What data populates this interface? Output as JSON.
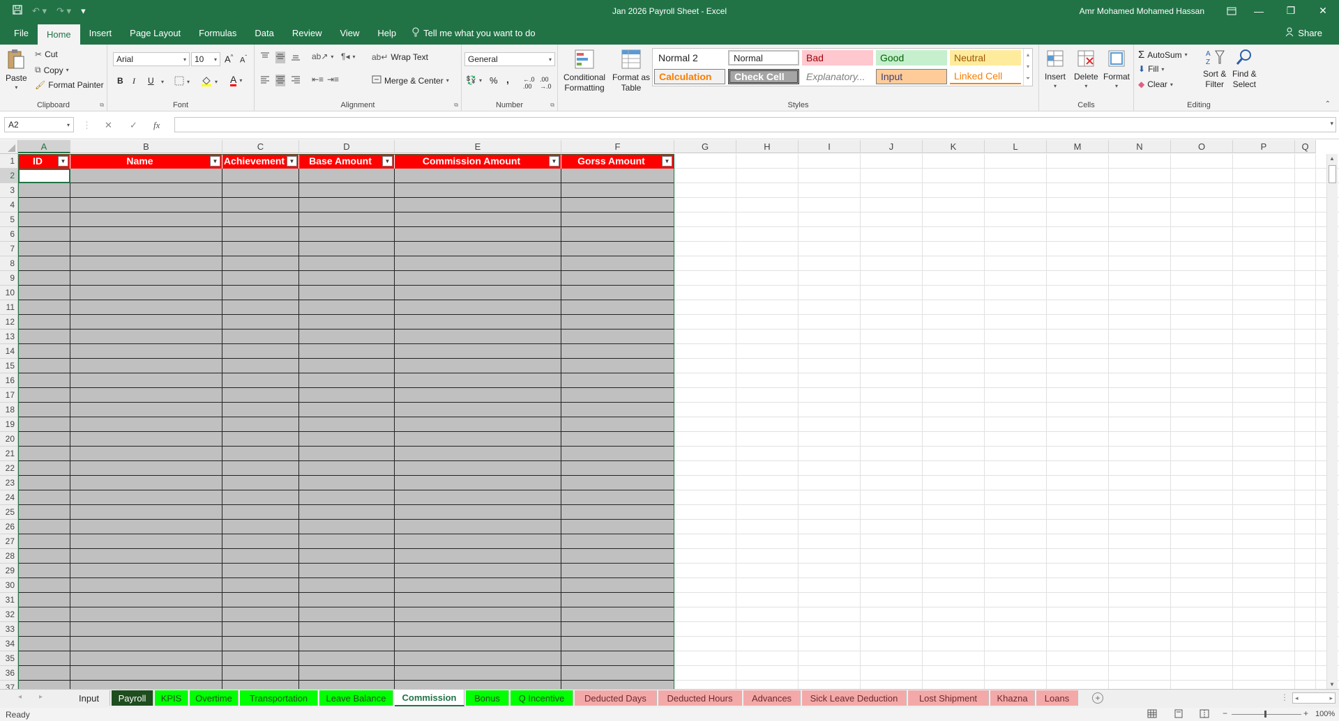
{
  "window": {
    "title": "Jan 2026 Payroll Sheet  -  Excel",
    "user": "Amr Mohamed Mohamed Hassan",
    "minimize": "—",
    "restore": "❐",
    "close": "✕"
  },
  "menu": {
    "file": "File",
    "home": "Home",
    "insert": "Insert",
    "page_layout": "Page Layout",
    "formulas": "Formulas",
    "data": "Data",
    "review": "Review",
    "view": "View",
    "help": "Help",
    "tell_me": "Tell me what you want to do",
    "share": "Share"
  },
  "ribbon": {
    "clipboard": {
      "label": "Clipboard",
      "paste": "Paste",
      "cut": "Cut",
      "copy": "Copy",
      "format_painter": "Format Painter"
    },
    "font": {
      "label": "Font",
      "name": "Arial",
      "size": "10",
      "bold": "B",
      "italic": "I",
      "underline": "U"
    },
    "alignment": {
      "label": "Alignment",
      "wrap_text": "Wrap Text",
      "merge_center": "Merge & Center"
    },
    "number": {
      "label": "Number",
      "format": "General",
      "percent": "%",
      "comma": ","
    },
    "styles": {
      "label": "Styles",
      "conditional_1": "Conditional",
      "conditional_2": "Formatting",
      "format_table_1": "Format as",
      "format_table_2": "Table",
      "normal2": "Normal 2",
      "normal": "Normal",
      "bad": "Bad",
      "good": "Good",
      "neutral": "Neutral",
      "calculation": "Calculation",
      "check_cell": "Check Cell",
      "explanatory": "Explanatory...",
      "input": "Input",
      "linked_cell": "Linked Cell"
    },
    "cells": {
      "label": "Cells",
      "insert": "Insert",
      "delete": "Delete",
      "format": "Format"
    },
    "editing": {
      "label": "Editing",
      "autosum": "AutoSum",
      "fill": "Fill",
      "clear": "Clear",
      "sort_1": "Sort &",
      "sort_2": "Filter",
      "find_1": "Find &",
      "find_2": "Select"
    }
  },
  "formula_bar": {
    "name_box": "A2",
    "fx": "fx",
    "value": ""
  },
  "grid": {
    "columns": [
      "A",
      "B",
      "C",
      "D",
      "E",
      "F",
      "G",
      "H",
      "I",
      "J",
      "K",
      "L",
      "M",
      "N",
      "O",
      "P",
      "Q"
    ],
    "rows": [
      "1",
      "2",
      "3",
      "4",
      "5",
      "6",
      "7",
      "8",
      "9",
      "10",
      "11",
      "12",
      "13",
      "14",
      "15",
      "16",
      "17",
      "18",
      "19",
      "20",
      "21",
      "22",
      "23",
      "24",
      "25",
      "26",
      "27",
      "28",
      "29",
      "30",
      "31",
      "32",
      "33",
      "34",
      "35",
      "36",
      "37"
    ],
    "headers": [
      "ID",
      "Name",
      "Achievement",
      "Base Amount",
      "Commission Amount",
      "Gorss Amount"
    ],
    "filter_glyph": "▼"
  },
  "sheet_tabs": [
    {
      "label": "Input",
      "bg": "#efefef",
      "color": "#262626"
    },
    {
      "label": "Payroll",
      "bg": "#1e4d1e",
      "color": "#ffffff"
    },
    {
      "label": "KPIS",
      "bg": "#00ff00",
      "color": "#1e4d1e"
    },
    {
      "label": "Overtime",
      "bg": "#00ff00",
      "color": "#1e4d1e"
    },
    {
      "label": "Transportation",
      "bg": "#00ff00",
      "color": "#1e4d1e"
    },
    {
      "label": "Leave Balance",
      "bg": "#00ff00",
      "color": "#1e4d1e"
    },
    {
      "label": "Commission",
      "bg": "#ffffff",
      "color": "#217346"
    },
    {
      "label": "Bonus",
      "bg": "#00ff00",
      "color": "#1e4d1e"
    },
    {
      "label": "Q Incentive",
      "bg": "#00ff00",
      "color": "#1e4d1e"
    },
    {
      "label": "Deducted Days",
      "bg": "#f4a9a9",
      "color": "#6b2b2b"
    },
    {
      "label": "Deducted Hours",
      "bg": "#f4a9a9",
      "color": "#6b2b2b"
    },
    {
      "label": "Advances",
      "bg": "#f4a9a9",
      "color": "#6b2b2b"
    },
    {
      "label": "Sick Leave Deduction",
      "bg": "#f4a9a9",
      "color": "#6b2b2b"
    },
    {
      "label": "Lost Shipment",
      "bg": "#f4a9a9",
      "color": "#6b2b2b"
    },
    {
      "label": "Khazna",
      "bg": "#f4a9a9",
      "color": "#6b2b2b"
    },
    {
      "label": "Loans",
      "bg": "#f4a9a9",
      "color": "#6b2b2b"
    }
  ],
  "status": {
    "ready": "Ready",
    "zoom": "100%"
  }
}
